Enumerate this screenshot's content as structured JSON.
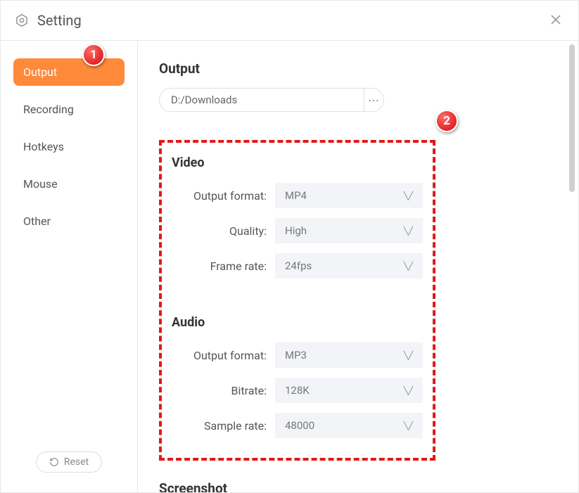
{
  "header": {
    "title": "Setting"
  },
  "sidebar": {
    "items": [
      {
        "label": "Output",
        "active": true
      },
      {
        "label": "Recording",
        "active": false
      },
      {
        "label": "Hotkeys",
        "active": false
      },
      {
        "label": "Mouse",
        "active": false
      },
      {
        "label": "Other",
        "active": false
      }
    ],
    "reset_label": "Reset"
  },
  "output": {
    "title": "Output",
    "path": "D:/Downloads",
    "video": {
      "title": "Video",
      "format_label": "Output format:",
      "format_value": "MP4",
      "quality_label": "Quality:",
      "quality_value": "High",
      "framerate_label": "Frame rate:",
      "framerate_value": "24fps"
    },
    "audio": {
      "title": "Audio",
      "format_label": "Output format:",
      "format_value": "MP3",
      "bitrate_label": "Bitrate:",
      "bitrate_value": "128K",
      "samplerate_label": "Sample rate:",
      "samplerate_value": "48000"
    },
    "screenshot_title": "Screenshot"
  },
  "callouts": {
    "one": "1",
    "two": "2"
  }
}
